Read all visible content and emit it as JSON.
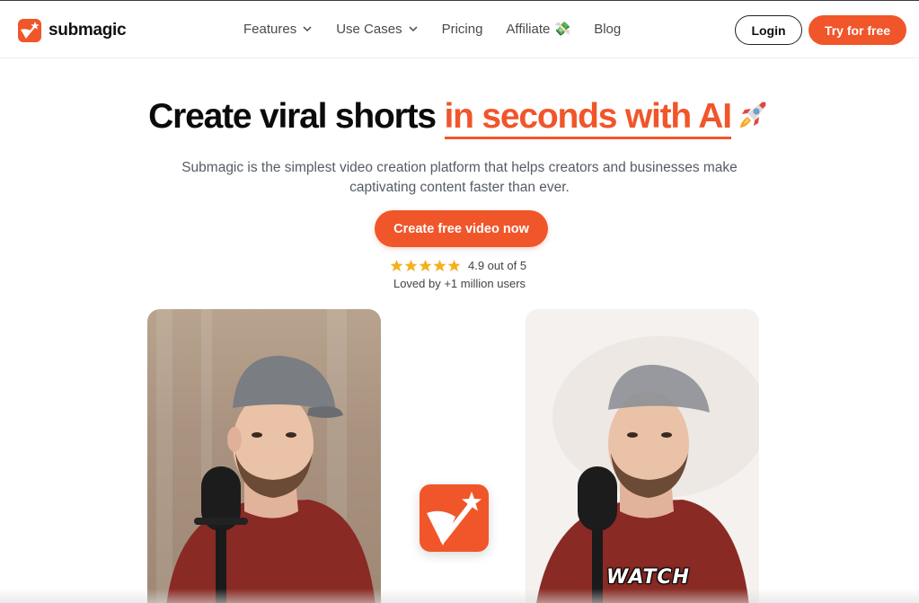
{
  "brand": {
    "name": "submagic",
    "accent": "#f0562a"
  },
  "nav": {
    "items": [
      {
        "label": "Features",
        "has_dropdown": true
      },
      {
        "label": "Use Cases",
        "has_dropdown": true
      },
      {
        "label": "Pricing",
        "has_dropdown": false
      },
      {
        "label": "Affiliate 💸",
        "has_dropdown": false
      },
      {
        "label": "Blog",
        "has_dropdown": false
      }
    ],
    "login_label": "Login",
    "try_label": "Try for free"
  },
  "hero": {
    "title_plain": "Create viral shorts ",
    "title_accent": "in seconds with AI",
    "subtitle": "Submagic is the simplest video creation platform that helps creators and businesses make captivating content faster than ever.",
    "cta_label": "Create free video now",
    "rating_text": "4.9 out of 5",
    "rating_value": 4.9,
    "stars": 5,
    "loved_text": "Loved by +1 million users"
  },
  "preview": {
    "caption_word": "WATCH"
  },
  "icons": {
    "logo": "magic-wand-icon",
    "chevron": "chevron-down-icon",
    "rocket": "rocket-icon",
    "star": "star-icon"
  }
}
